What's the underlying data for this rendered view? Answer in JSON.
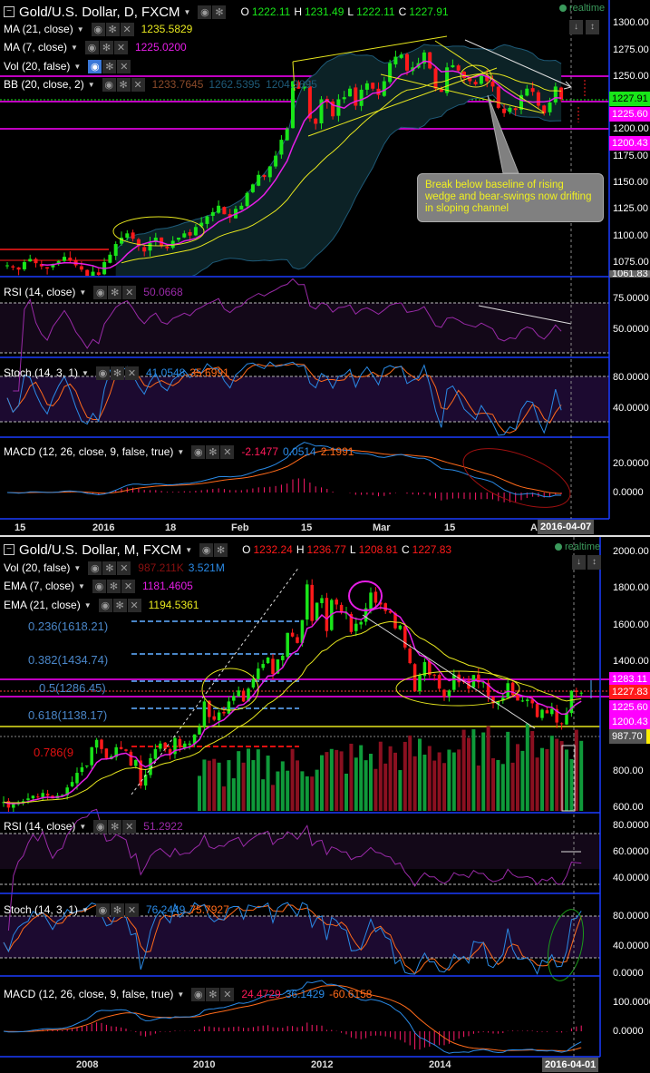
{
  "daily": {
    "title": "Gold/U.S. Dollar, D, FXCM",
    "ohlc": {
      "o_label": "O",
      "o": "1222.11",
      "h_label": "H",
      "h": "1231.49",
      "l_label": "L",
      "l": "1222.11",
      "c_label": "C",
      "c": "1227.91"
    },
    "realtime": "realtime",
    "indicators": [
      {
        "name": "MA (21, close)",
        "values": [
          "1235.5829"
        ]
      },
      {
        "name": "MA (7, close)",
        "values": [
          "1225.0200"
        ]
      },
      {
        "name": "Vol (20, false)",
        "values": []
      },
      {
        "name": "BB (20, close, 2)",
        "values": [
          "1233.7645",
          "1262.5395",
          "1204.9895"
        ]
      }
    ],
    "rsi": {
      "name": "RSI (14, close)",
      "values": [
        "50.0668"
      ]
    },
    "stoch": {
      "name": "Stoch (14, 3, 1)",
      "values": [
        "41.0548",
        "35.6991"
      ]
    },
    "macd": {
      "name": "MACD (12, 26, close, 9, false, true)",
      "values": [
        "-2.1477",
        "0.0514",
        "2.1991"
      ]
    },
    "price_axis": [
      "1300.00",
      "1275.00",
      "1250.00",
      "1200.00",
      "1175.00",
      "1150.00",
      "1125.00",
      "1100.00",
      "1075.00"
    ],
    "price_badges": {
      "last": "1227.91",
      "ma7": "1225.60",
      "bb_low": "1200.43",
      "low": "1061.83"
    },
    "rsi_axis": [
      "75.0000",
      "50.0000"
    ],
    "stoch_axis": [
      "80.0000",
      "40.0000"
    ],
    "macd_axis": [
      "20.0000",
      "0.0000"
    ],
    "time_axis": [
      "15",
      "2016",
      "18",
      "Feb",
      "15",
      "Mar",
      "15",
      "A"
    ],
    "cursor_date": "2016-04-07",
    "annotation": "Break below baseline of rising wedge and bear-swings now drifting in sloping channel",
    "closes": [
      1072,
      1070,
      1068,
      1075,
      1078,
      1074,
      1071,
      1069,
      1073,
      1076,
      1080,
      1077,
      1072,
      1068,
      1062,
      1066,
      1063,
      1075,
      1082,
      1092,
      1098,
      1102,
      1097,
      1090,
      1085,
      1093,
      1098,
      1090,
      1088,
      1095,
      1098,
      1102,
      1100,
      1108,
      1112,
      1118,
      1122,
      1128,
      1120,
      1117,
      1125,
      1128,
      1140,
      1148,
      1157,
      1155,
      1165,
      1175,
      1190,
      1200,
      1245,
      1238,
      1240,
      1210,
      1205,
      1228,
      1225,
      1212,
      1228,
      1230,
      1238,
      1222,
      1237,
      1243,
      1238,
      1232,
      1245,
      1262,
      1268,
      1270,
      1255,
      1258,
      1262,
      1272,
      1257,
      1238,
      1235,
      1258,
      1260,
      1255,
      1248,
      1245,
      1242,
      1250,
      1245,
      1240,
      1220,
      1215,
      1220,
      1218,
      1232,
      1238,
      1235,
      1222,
      1215,
      1225,
      1240,
      1228
    ]
  },
  "monthly": {
    "title": "Gold/U.S. Dollar, M, FXCM",
    "ohlc": {
      "o_label": "O",
      "o": "1232.24",
      "h_label": "H",
      "h": "1236.77",
      "l_label": "L",
      "l": "1208.81",
      "c_label": "C",
      "c": "1227.83"
    },
    "realtime": "realtime",
    "indicators": [
      {
        "name": "Vol (20, false)",
        "values": [
          "987.211K",
          "3.521M"
        ]
      },
      {
        "name": "EMA (7, close)",
        "values": [
          "1181.4605"
        ]
      },
      {
        "name": "EMA (21, close)",
        "values": [
          "1194.5361"
        ]
      }
    ],
    "rsi": {
      "name": "RSI (14, close)",
      "values": [
        "51.2922"
      ]
    },
    "stoch": {
      "name": "Stoch (14, 3, 1)",
      "values": [
        "76.2449",
        "75.7927"
      ]
    },
    "macd": {
      "name": "MACD (12, 26, close, 9, false, true)",
      "values": [
        "24.4729",
        "36.1429",
        "-60.6158"
      ]
    },
    "fib": [
      "0.236(1618.21)",
      "0.382(1434.74)",
      "0.5(1286.45)",
      "0.618(1138.17)",
      "0.786(9"
    ],
    "price_axis": [
      "2000.00",
      "1800.00",
      "1600.00",
      "1400.00",
      "800.00",
      "600.00"
    ],
    "price_badges": {
      "resist": "1283.11",
      "last": "1227.83",
      "ma": "1225.60",
      "support": "1200.43",
      "volume": "987.70"
    },
    "rsi_axis": [
      "80.0000",
      "60.0000",
      "40.0000"
    ],
    "stoch_axis": [
      "80.0000",
      "40.0000",
      "0.0000"
    ],
    "macd_axis": [
      "100.0000",
      "0.0000"
    ],
    "time_axis": [
      "2008",
      "2010",
      "2012",
      "2014"
    ],
    "cursor_date": "2016-04-01",
    "closes": [
      630,
      600,
      620,
      630,
      635,
      650,
      665,
      660,
      680,
      665,
      650,
      665,
      670,
      710,
      740,
      790,
      820,
      830,
      930,
      970,
      920,
      870,
      880,
      930,
      920,
      910,
      830,
      860,
      720,
      780,
      870,
      920,
      950,
      920,
      890,
      980,
      930,
      950,
      950,
      1000,
      1040,
      1180,
      1095,
      1080,
      1120,
      1115,
      1180,
      1210,
      1240,
      1180,
      1250,
      1305,
      1360,
      1385,
      1420,
      1330,
      1410,
      1430,
      1555,
      1535,
      1500,
      1625,
      1820,
      1620,
      1720,
      1745,
      1565,
      1735,
      1710,
      1665,
      1665,
      1560,
      1605,
      1615,
      1690,
      1775,
      1720,
      1710,
      1675,
      1665,
      1580,
      1595,
      1475,
      1390,
      1235,
      1325,
      1395,
      1325,
      1325,
      1250,
      1205,
      1240,
      1325,
      1285,
      1290,
      1250,
      1325,
      1285,
      1285,
      1210,
      1170,
      1180,
      1200,
      1280,
      1215,
      1185,
      1185,
      1190,
      1170,
      1095,
      1135,
      1115,
      1140,
      1065,
      1060,
      1118,
      1238,
      1232,
      1228
    ]
  },
  "colors": {
    "up": "#19e619",
    "down": "#ff1a1a",
    "ma_fast": "#e61ee6",
    "ma_slow": "#e6e61e",
    "rsi": "#9a2aa8",
    "k": "#2a8ae6",
    "d": "#ff6a1a",
    "axis": "#1a3cff"
  }
}
